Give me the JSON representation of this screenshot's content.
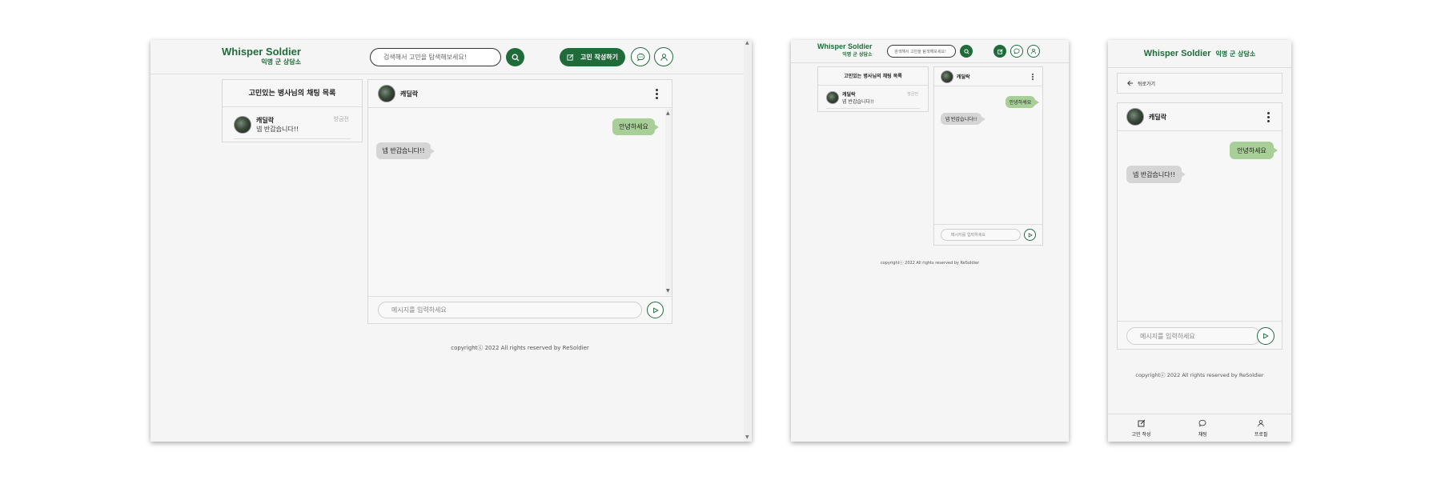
{
  "brand": {
    "title": "Whisper Soldier",
    "subtitle": "익명 군 상담소"
  },
  "header": {
    "search_placeholder": "검색해서 고민을 탐색해보세요!",
    "write_button_label": "고민 작성하기"
  },
  "chat_list": {
    "title": "고민있는 병사님의 채팅 목록",
    "items": [
      {
        "name": "캐딜락",
        "last_message": "넵 반갑습니다!!",
        "time": "방금전"
      }
    ]
  },
  "chat_room": {
    "partner_name": "캐딜락",
    "messages": [
      {
        "from": "me",
        "text": "안녕하세요"
      },
      {
        "from": "other",
        "text": "넵 반갑습니다!!"
      }
    ],
    "input_placeholder": "메시지를 입력하세요"
  },
  "back_label": "뒤로가기",
  "copyright": "copyrightⓒ 2022 All rights reserved by ReSoldier",
  "bottom_nav": [
    {
      "label": "고민 작성",
      "icon": "edit-icon"
    },
    {
      "label": "채팅",
      "icon": "chat-icon"
    },
    {
      "label": "프로필",
      "icon": "profile-icon"
    }
  ],
  "colors": {
    "brand_green": "#1f6b3a",
    "my_bubble": "#a9cf98",
    "other_bubble": "#d5d5d5",
    "background": "#f5f5f5"
  }
}
